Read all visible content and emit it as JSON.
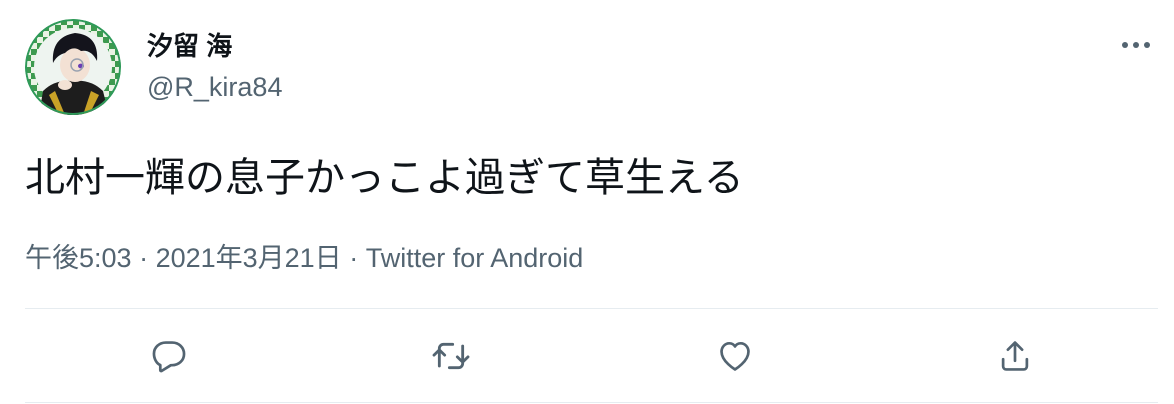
{
  "user": {
    "display_name": "汐留 海",
    "handle": "@R_kira84",
    "avatar_icon": "avatar-illustration"
  },
  "tweet": {
    "text": "北村一輝の息子かっこよ過ぎて草生える"
  },
  "meta": {
    "time": "午後5:03",
    "separator1": " · ",
    "date": "2021年3月21日",
    "separator2": " · ",
    "source": "Twitter for Android"
  },
  "actions": {
    "reply_icon": "reply-icon",
    "retweet_icon": "retweet-icon",
    "like_icon": "heart-icon",
    "share_icon": "share-icon",
    "more_icon": "more-icon"
  },
  "colors": {
    "text_primary": "#0f1419",
    "text_secondary": "#536471",
    "divider": "#e6ecf0",
    "avatar_ring": "#2f9a5a"
  }
}
